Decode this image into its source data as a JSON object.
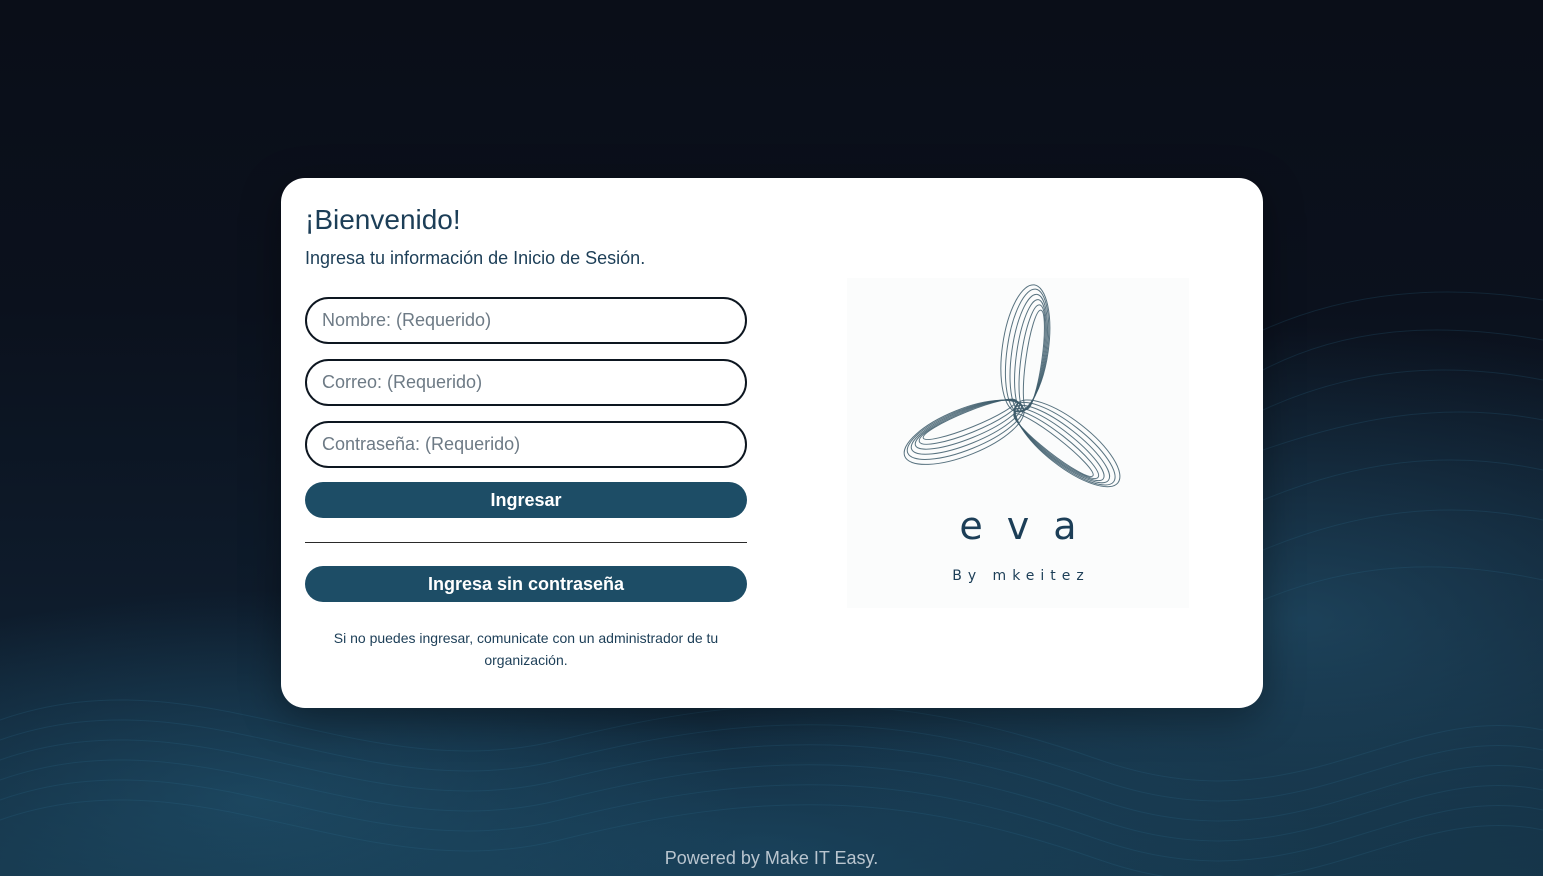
{
  "login": {
    "title": "¡Bienvenido!",
    "subtitle": "Ingresa tu información de Inicio de Sesión.",
    "fields": {
      "name_placeholder": "Nombre: (Requerido)",
      "email_placeholder": "Correo: (Requerido)",
      "password_placeholder": "Contraseña: (Requerido)",
      "name_value": "",
      "email_value": "",
      "password_value": ""
    },
    "submit_label": "Ingresar",
    "passwordless_label": "Ingresa sin contraseña",
    "help_text": "Si no puedes ingresar, comunicate con un administrador de tu organización."
  },
  "logo": {
    "brand": "eva",
    "tagline": "By mkeitez",
    "icon": "tri-lobe-wireframe-icon"
  },
  "footer": {
    "text": "Powered by Make IT Easy."
  },
  "colors": {
    "primary": "#1d4d66",
    "text": "#1c3e57",
    "card": "#ffffff",
    "background": "#0b111d"
  }
}
